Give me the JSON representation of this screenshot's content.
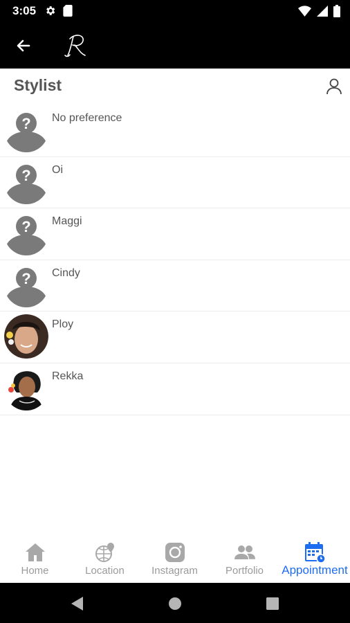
{
  "status_bar": {
    "time": "3:05",
    "icons": [
      "gear-icon",
      "sd-card-icon",
      "wifi-icon",
      "signal-icon",
      "battery-icon"
    ]
  },
  "app_bar": {
    "back_icon": "arrow-left-icon",
    "logo_icon": "script-r-logo"
  },
  "header": {
    "title": "Stylist",
    "profile_icon": "person-outline-icon"
  },
  "stylists": [
    {
      "name": "No preference",
      "avatar": "placeholder-question-avatar"
    },
    {
      "name": "Oi",
      "avatar": "placeholder-question-avatar"
    },
    {
      "name": "Maggi",
      "avatar": "placeholder-question-avatar"
    },
    {
      "name": "Cindy",
      "avatar": "placeholder-question-avatar"
    },
    {
      "name": "Ploy",
      "avatar": "photo-avatar"
    },
    {
      "name": "Rekka",
      "avatar": "photo-avatar"
    }
  ],
  "bottom_nav": {
    "items": [
      {
        "label": "Home",
        "icon": "home-icon"
      },
      {
        "label": "Location",
        "icon": "globe-pin-icon"
      },
      {
        "label": "Instagram",
        "icon": "instagram-icon"
      },
      {
        "label": "Portfolio",
        "icon": "people-icon"
      },
      {
        "label": "Appointment",
        "icon": "calendar-icon",
        "active": true
      }
    ]
  },
  "colors": {
    "accent": "#1e6cf0",
    "inactive": "#9a9a9a",
    "placeholder_grey": "#7a7a7a"
  }
}
